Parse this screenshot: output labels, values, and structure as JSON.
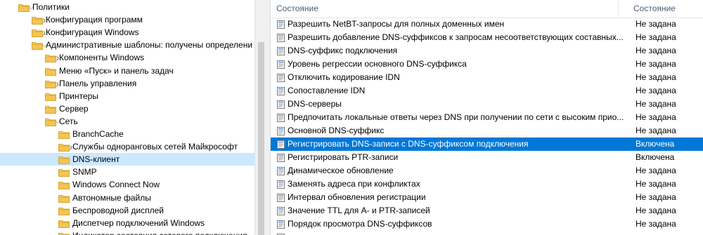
{
  "tree": {
    "items": [
      {
        "label": "Политики",
        "depth": 0,
        "chevron": "down"
      },
      {
        "label": "Конфигурация программ",
        "depth": 1,
        "chevron": "right"
      },
      {
        "label": "Конфигурация Windows",
        "depth": 1,
        "chevron": "right"
      },
      {
        "label": "Административные шаблоны: получены определени",
        "depth": 1,
        "chevron": "down"
      },
      {
        "label": "Компоненты Windows",
        "depth": 2,
        "chevron": "right"
      },
      {
        "label": "Меню «Пуск» и панель задач",
        "depth": 2,
        "chevron": ""
      },
      {
        "label": "Панель управления",
        "depth": 2,
        "chevron": "right"
      },
      {
        "label": "Принтеры",
        "depth": 2,
        "chevron": ""
      },
      {
        "label": "Сервер",
        "depth": 2,
        "chevron": ""
      },
      {
        "label": "Сеть",
        "depth": 2,
        "chevron": "down"
      },
      {
        "label": "BranchCache",
        "depth": 3,
        "chevron": ""
      },
      {
        "label": "Службы одноранговых сетей Майкрософт",
        "depth": 3,
        "chevron": "right"
      },
      {
        "label": "DNS-клиент",
        "depth": 3,
        "chevron": "",
        "selected": true
      },
      {
        "label": "SNMP",
        "depth": 3,
        "chevron": ""
      },
      {
        "label": "Windows Connect Now",
        "depth": 3,
        "chevron": ""
      },
      {
        "label": "Автономные файлы",
        "depth": 3,
        "chevron": ""
      },
      {
        "label": "Беспроводной дисплей",
        "depth": 3,
        "chevron": ""
      },
      {
        "label": "Диспетчер подключений Windows",
        "depth": 3,
        "chevron": ""
      },
      {
        "label": "Индикатор состояния сетевого подключения",
        "depth": 3,
        "chevron": ""
      }
    ]
  },
  "list": {
    "header": {
      "name": "Состояние",
      "state": "Состояние"
    },
    "rows": [
      {
        "name": "Разрешить NetBT-запросы для полных доменных имен",
        "state": "Не задана"
      },
      {
        "name": "Разрешить добавление DNS-суффиксов к запросам несоответствующих составных...",
        "state": "Не задана"
      },
      {
        "name": "DNS-суффикс подключения",
        "state": "Не задана"
      },
      {
        "name": "Уровень регрессии основного DNS-суффикса",
        "state": "Не задана"
      },
      {
        "name": "Отключить кодирование IDN",
        "state": "Не задана"
      },
      {
        "name": "Сопоставление IDN",
        "state": "Не задана"
      },
      {
        "name": "DNS-серверы",
        "state": "Не задана"
      },
      {
        "name": "Предпочитать локальные ответы через DNS при получении по сети с высоким прио...",
        "state": "Не задана"
      },
      {
        "name": "Основной DNS-суффикс",
        "state": "Не задана"
      },
      {
        "name": "Регистрировать DNS-записи с DNS-суффиксом подключения",
        "state": "Включена",
        "selected": true
      },
      {
        "name": "Регистрировать PTR-записи",
        "state": "Включена"
      },
      {
        "name": "Динамическое обновление",
        "state": "Не задана"
      },
      {
        "name": "Заменять адреса при конфликтах",
        "state": "Не задана"
      },
      {
        "name": "Интервал обновления регистрации",
        "state": "Не задана"
      },
      {
        "name": "Значение TTL для A- и PTR-записей",
        "state": "Не задана"
      },
      {
        "name": "Порядок просмотра DNS-суффиксов",
        "state": "Не задана"
      },
      {
        "name": "",
        "state": ""
      }
    ]
  },
  "colors": {
    "selection": "#0078d7",
    "tree_selection": "#cce8ff",
    "folder": "#e8b93a",
    "header_text": "#4c607a"
  },
  "icons": {
    "folder": "folder-icon",
    "policy": "policy-setting-icon",
    "expand": "chevron-right-icon",
    "collapse": "chevron-down-icon"
  }
}
